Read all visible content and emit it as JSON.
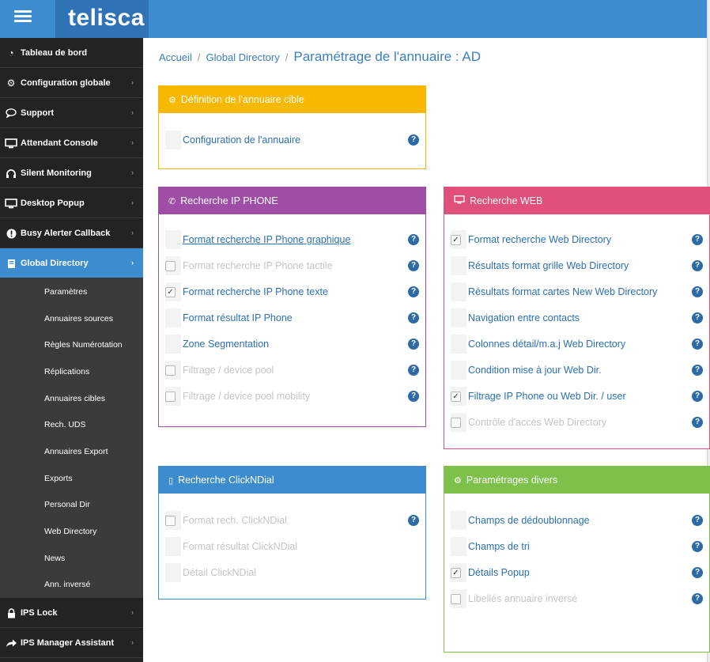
{
  "header": {
    "menu_icon": "hamburger-icon",
    "logo": "telisca",
    "accent": "#3d8cd0"
  },
  "sidebar": {
    "items_top": [
      {
        "label": "Tableau de bord",
        "icon": "dashboard-icon"
      },
      {
        "label": "Configuration globale",
        "icon": "gears-icon"
      },
      {
        "label": "Support",
        "icon": "speech-bubble-icon"
      },
      {
        "label": "Attendant Console",
        "icon": "monitor-icon"
      },
      {
        "label": "Silent Monitoring",
        "icon": "headphones-icon"
      },
      {
        "label": "Desktop Popup",
        "icon": "monitor-icon"
      },
      {
        "label": "Busy Alerter Callback",
        "icon": "alert-icon"
      },
      {
        "label": "Global Directory",
        "icon": "book-icon"
      }
    ],
    "subitems": [
      "Paramètres",
      "Annuaires sources",
      "Règles Numérotation",
      "Réplications",
      "Annuaires cibles",
      "Rech. UDS",
      "Annuaires Export",
      "Exports",
      "Personal Dir",
      "Web Directory",
      "News",
      "Ann. inversé"
    ],
    "items_bottom": [
      {
        "label": "IPS Lock",
        "icon": "lock-icon"
      },
      {
        "label": "IPS Manager Assistant",
        "icon": "share-arrow-icon"
      }
    ]
  },
  "breadcrumb": {
    "home": "Accueil",
    "section": "Global Directory",
    "current": "Paramétrage de l'annuaire : AD"
  },
  "panels": {
    "definition": {
      "title": "Définition de l'annuaire cible",
      "color": "#f9b800",
      "rows": [
        {
          "label": "Configuration de l'annuaire"
        }
      ]
    },
    "ipphone": {
      "title": "Recherche IP PHONE",
      "color": "#9e4fa5",
      "rows": [
        {
          "label": "Format recherche IP Phone graphique"
        },
        {
          "label": "Format recherche IP Phone tactile"
        },
        {
          "label": "Format recherche IP Phone texte",
          "check": "✓"
        },
        {
          "label": "Format résultat IP Phone"
        },
        {
          "label": "Zone Segmentation"
        },
        {
          "label": "Filtrage / device pool"
        },
        {
          "label": "Filtrage / device pool mobility"
        }
      ]
    },
    "web": {
      "title": "Recherche WEB",
      "color": "#e14f7b",
      "rows": [
        {
          "label": "Format recherche Web Directory",
          "check": "✓"
        },
        {
          "label": "Résultats format grille Web Directory"
        },
        {
          "label": "Résultats format cartes New Web Directory"
        },
        {
          "label": "Navigation entre contacts"
        },
        {
          "label": "Colonnes détail/m.a.j Web Directory"
        },
        {
          "label": "Condition mise à jour Web Dir."
        },
        {
          "label": "Filtrage IP Phone ou Web Dir. / user",
          "check": "✓"
        },
        {
          "label": "Contrôle d'accès Web Directory"
        }
      ]
    },
    "clickndial": {
      "title": "Recherche ClickNDial",
      "color": "#3d8cd0",
      "rows": [
        {
          "label": "Format rech. ClickNDial"
        },
        {
          "label": "Format résultat ClickNDial"
        },
        {
          "label": "Détail ClickNDial"
        }
      ]
    },
    "divers": {
      "title": "Paramétrages divers",
      "color": "#7dc14b",
      "rows": [
        {
          "label": "Champs de dédoublonnage"
        },
        {
          "label": "Champs de tri"
        },
        {
          "label": "Détails Popup",
          "check": "✓"
        },
        {
          "label": "Libellés annuaire inversé"
        }
      ]
    }
  },
  "help_glyph": "?",
  "chevron_glyph": "›"
}
